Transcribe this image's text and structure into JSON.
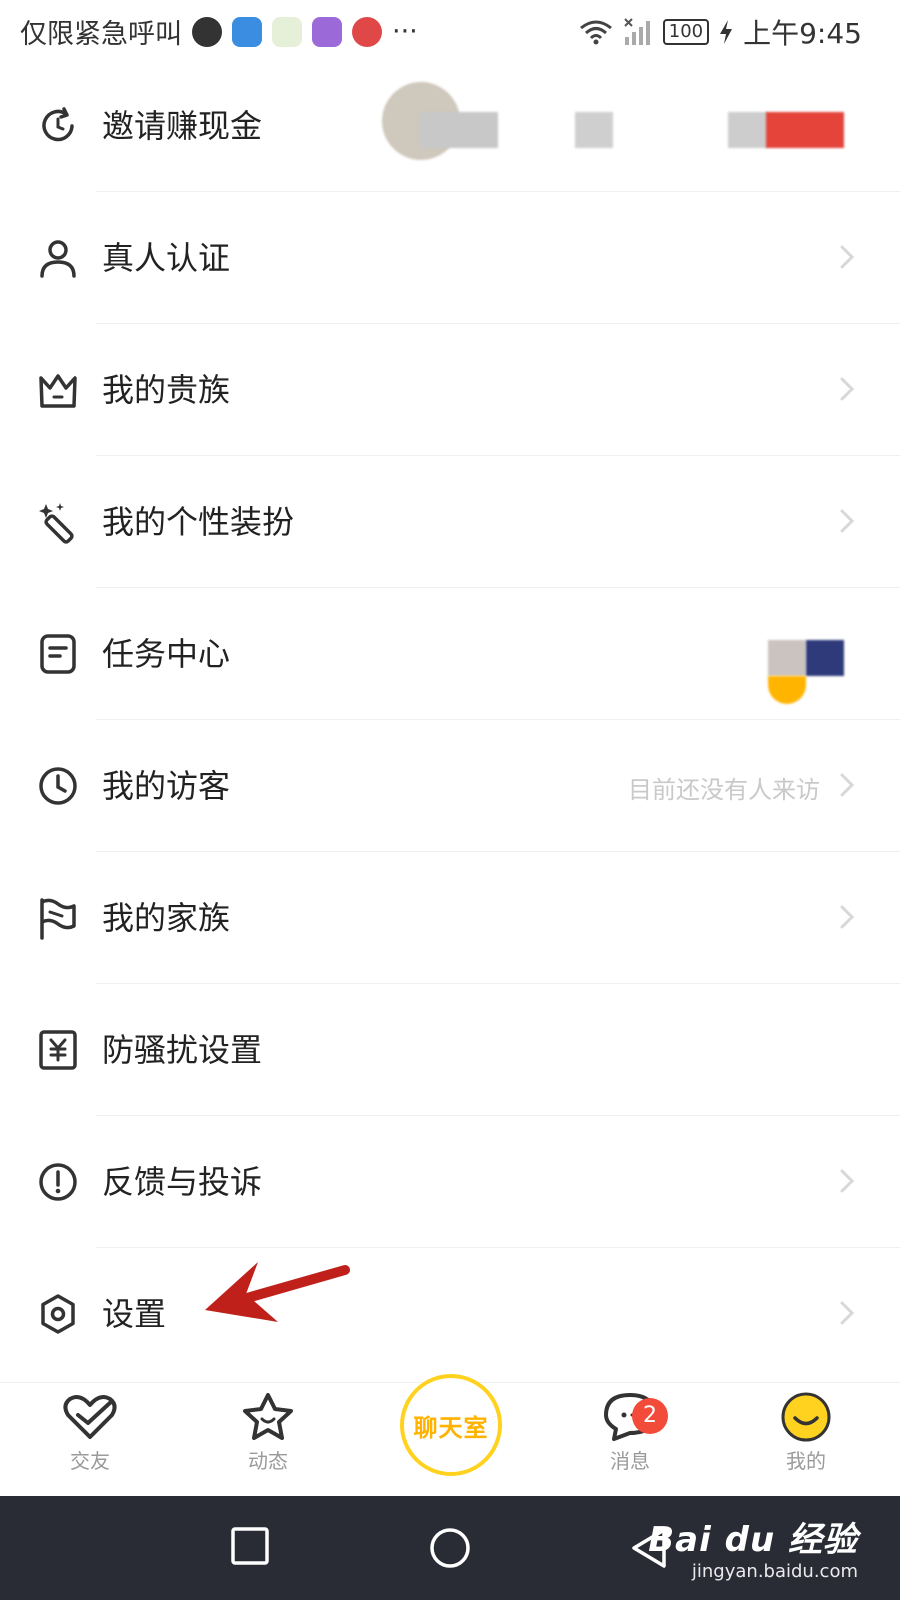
{
  "status_bar": {
    "left_text": "仅限紧急呼叫",
    "battery": "100",
    "time": "上午9:45",
    "more": "···"
  },
  "menu": {
    "items": [
      {
        "label": "邀请赚现金",
        "icon": "refresh-arrow-icon"
      },
      {
        "label": "真人认证",
        "icon": "person-icon"
      },
      {
        "label": "我的贵族",
        "icon": "crown-icon"
      },
      {
        "label": "我的个性装扮",
        "icon": "magic-wand-icon"
      },
      {
        "label": "任务中心",
        "icon": "task-note-icon"
      },
      {
        "label": "我的访客",
        "icon": "clock-icon",
        "hint": "目前还没有人来访"
      },
      {
        "label": "我的家族",
        "icon": "flag-icon"
      },
      {
        "label": "防骚扰设置",
        "icon": "yen-shield-icon"
      },
      {
        "label": "反馈与投诉",
        "icon": "exclamation-circle-icon"
      },
      {
        "label": "设置",
        "icon": "settings-icon"
      }
    ]
  },
  "tabbar": {
    "tabs": [
      {
        "label": "交友",
        "icon": "heart-check-icon"
      },
      {
        "label": "动态",
        "icon": "star-icon"
      },
      {
        "label": "消息",
        "icon": "chat-bubble-icon",
        "badge": "2"
      },
      {
        "label": "我的",
        "icon": "smiley-icon"
      }
    ],
    "center_label": "聊天室"
  },
  "watermark": {
    "logo": "Bai du 经验",
    "url": "jingyan.baidu.com"
  },
  "colors": {
    "accent_yellow": "#ffd21f",
    "badge_red": "#f24b3a",
    "arrow_red": "#c0201a",
    "navbar": "#2a2c35"
  }
}
